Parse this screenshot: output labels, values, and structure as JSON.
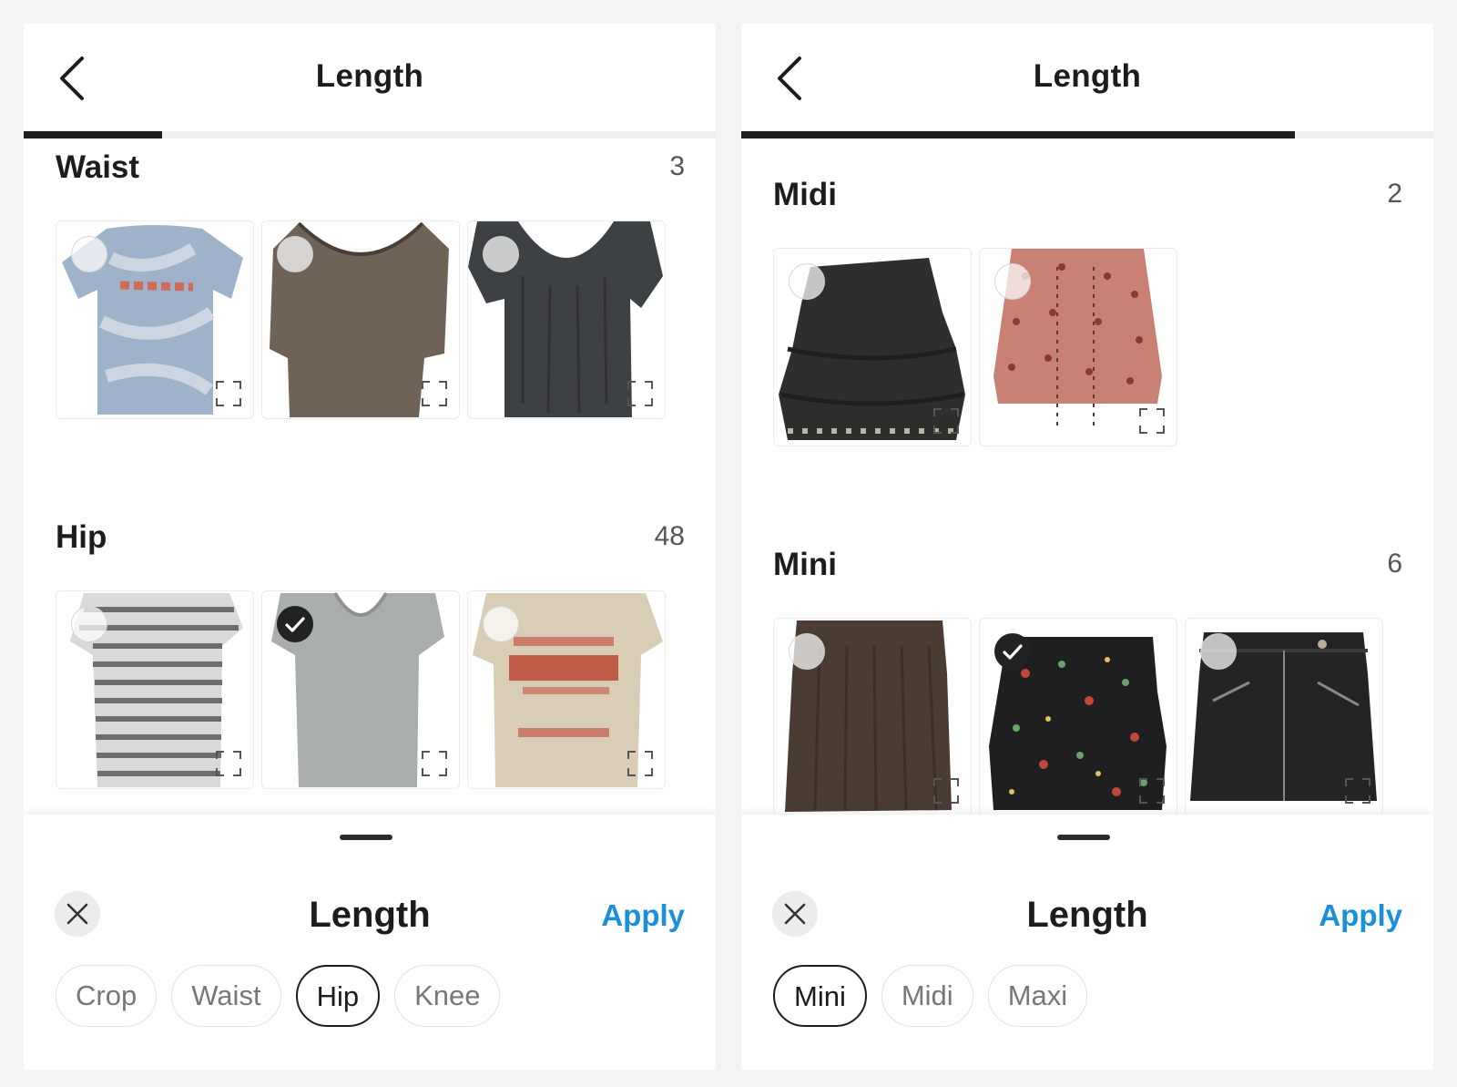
{
  "accent_color": "#1a8fdb",
  "panels": {
    "left": {
      "header": {
        "title": "Length",
        "back_icon": "chevron-left-icon",
        "progress": 0.2
      },
      "sections": [
        {
          "title": "Waist",
          "count": "3",
          "items": [
            {
              "desc": "blue tie-dye tee",
              "selected": false
            },
            {
              "desc": "brown knit top",
              "selected": false
            },
            {
              "desc": "dark grey flutter-sleeve top",
              "selected": false
            }
          ]
        },
        {
          "title": "Hip",
          "count": "48",
          "items": [
            {
              "desc": "grey striped tee",
              "selected": false
            },
            {
              "desc": "light grey v-neck tee",
              "selected": true
            },
            {
              "desc": "beige graphic tee",
              "selected": false
            }
          ]
        }
      ],
      "sheet": {
        "title": "Length",
        "apply_label": "Apply",
        "close_icon": "close-icon",
        "chips": [
          {
            "label": "Crop",
            "active": false
          },
          {
            "label": "Waist",
            "active": false
          },
          {
            "label": "Hip",
            "active": true
          },
          {
            "label": "Knee",
            "active": false
          }
        ]
      }
    },
    "right": {
      "header": {
        "title": "Length",
        "back_icon": "chevron-left-icon",
        "progress": 0.8
      },
      "sections": [
        {
          "title": "Midi",
          "count": "2",
          "items": [
            {
              "desc": "black ruffle skirt",
              "selected": false
            },
            {
              "desc": "pink polka-dot skirt",
              "selected": false
            }
          ]
        },
        {
          "title": "Mini",
          "count": "6",
          "items": [
            {
              "desc": "brown mini skirt",
              "selected": false
            },
            {
              "desc": "black floral print skirt",
              "selected": true
            },
            {
              "desc": "black leather mini skirt",
              "selected": false
            }
          ]
        }
      ],
      "sheet": {
        "title": "Length",
        "apply_label": "Apply",
        "close_icon": "close-icon",
        "chips": [
          {
            "label": "Mini",
            "active": true
          },
          {
            "label": "Midi",
            "active": false
          },
          {
            "label": "Maxi",
            "active": false
          }
        ]
      }
    }
  }
}
